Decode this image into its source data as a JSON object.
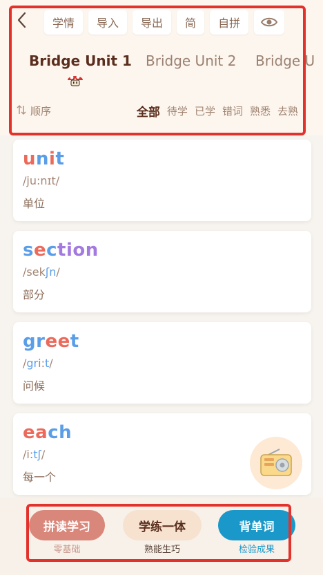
{
  "toolbar": {
    "study": "学情",
    "import": "导入",
    "export": "导出",
    "simple": "简",
    "self_spell": "自拼"
  },
  "units": [
    {
      "label": "Bridge Unit 1",
      "active": true
    },
    {
      "label": "Bridge Unit 2",
      "active": false
    },
    {
      "label": "Bridge U",
      "active": false
    }
  ],
  "sort_label": "顺序",
  "filters": [
    "全部",
    "待学",
    "已学",
    "错词",
    "熟悉",
    "去熟"
  ],
  "words": [
    {
      "parts": [
        {
          "t": "u",
          "c": "red"
        },
        {
          "t": "n",
          "c": "blue"
        },
        {
          "t": "i",
          "c": "red"
        },
        {
          "t": "t",
          "c": "blue"
        }
      ],
      "phon": [
        {
          "t": "/",
          "h": false
        },
        {
          "t": "ju:",
          "h": false
        },
        {
          "t": "n",
          "h": false
        },
        {
          "t": "ɪ",
          "h": false
        },
        {
          "t": "t",
          "h": false
        },
        {
          "t": "/",
          "h": false
        }
      ],
      "meaning": "单位"
    },
    {
      "parts": [
        {
          "t": "s",
          "c": "blue"
        },
        {
          "t": "e",
          "c": "red"
        },
        {
          "t": "c",
          "c": "blue"
        },
        {
          "t": "tion",
          "c": "purple"
        }
      ],
      "phon": [
        {
          "t": "/",
          "h": false
        },
        {
          "t": "s",
          "h": false
        },
        {
          "t": "e",
          "h": false
        },
        {
          "t": "k",
          "h": false
        },
        {
          "t": "ʃn",
          "h": true
        },
        {
          "t": "/",
          "h": false
        }
      ],
      "meaning": "部分"
    },
    {
      "parts": [
        {
          "t": "gr",
          "c": "blue"
        },
        {
          "t": "ee",
          "c": "red"
        },
        {
          "t": "t",
          "c": "blue"
        }
      ],
      "phon": [
        {
          "t": "/",
          "h": false
        },
        {
          "t": "gr",
          "h": true
        },
        {
          "t": "i:",
          "h": false
        },
        {
          "t": "t",
          "h": true
        },
        {
          "t": "/",
          "h": false
        }
      ],
      "meaning": "问候"
    },
    {
      "parts": [
        {
          "t": "ea",
          "c": "red"
        },
        {
          "t": "ch",
          "c": "blue"
        }
      ],
      "phon": [
        {
          "t": "/",
          "h": false
        },
        {
          "t": "i:",
          "h": false
        },
        {
          "t": "tʃ",
          "h": true
        },
        {
          "t": "/",
          "h": false
        }
      ],
      "meaning": "每一个"
    }
  ],
  "bottom": {
    "b1": {
      "label": "拼读学习",
      "sub": "零基础"
    },
    "b2": {
      "label": "学练一体",
      "sub": "熟能生巧"
    },
    "b3": {
      "label": "背单词",
      "sub": "检验成果"
    }
  },
  "icons": {
    "back": "chevron-left-icon",
    "eye": "eye-icon",
    "sort": "sort-arrows-icon",
    "radio": "radio-icon",
    "mushroom": "mushroom-icon"
  },
  "colors": {
    "accent_red": "#ec6a5b",
    "accent_blue": "#5b9ee8",
    "accent_purple": "#a37ae0",
    "btn1_bg": "#d9877b",
    "btn2_bg": "#f6e2cf",
    "btn3_bg": "#1a98c9"
  }
}
